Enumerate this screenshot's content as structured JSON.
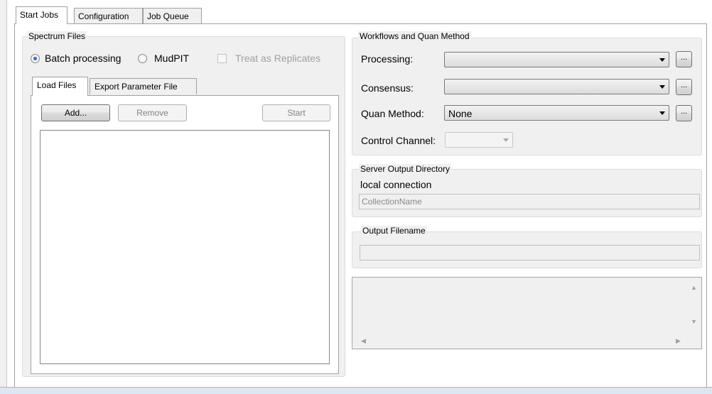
{
  "top_tabs": [
    {
      "label": "Start Jobs",
      "active": true
    },
    {
      "label": "Configuration",
      "active": false
    },
    {
      "label": "Job Queue",
      "active": false
    }
  ],
  "spectrum_files": {
    "title": "Spectrum Files",
    "batch_processing": {
      "label": "Batch processing",
      "checked": true
    },
    "mudpit": {
      "label": "MudPIT",
      "checked": false
    },
    "treat_as_replicates": {
      "label": "Treat as Replicates",
      "checked": false,
      "enabled": false
    },
    "inner_tabs": [
      {
        "label": "Load Files",
        "active": true
      },
      {
        "label": "Export Parameter File",
        "active": false
      }
    ],
    "buttons": {
      "add": "Add...",
      "remove": "Remove",
      "start": "Start"
    },
    "files": []
  },
  "workflows": {
    "title": "Workflows and Quan Method",
    "processing": {
      "label": "Processing:",
      "value": "",
      "browse": "..."
    },
    "consensus": {
      "label": "Consensus:",
      "value": "",
      "browse": "..."
    },
    "quan_method": {
      "label": "Quan Method:",
      "value": "None",
      "browse": "..."
    },
    "control_channel": {
      "label": "Control Channel:",
      "value": ""
    }
  },
  "server_output": {
    "title": "Server Output Directory",
    "connection": "local connection",
    "placeholder": "CollectionName"
  },
  "output_filename": {
    "title": "Output Filename",
    "value": ""
  },
  "log": {
    "text": ""
  },
  "scroll_icons": {
    "up": "▲",
    "down": "▼",
    "left": "◀",
    "right": "▶"
  }
}
